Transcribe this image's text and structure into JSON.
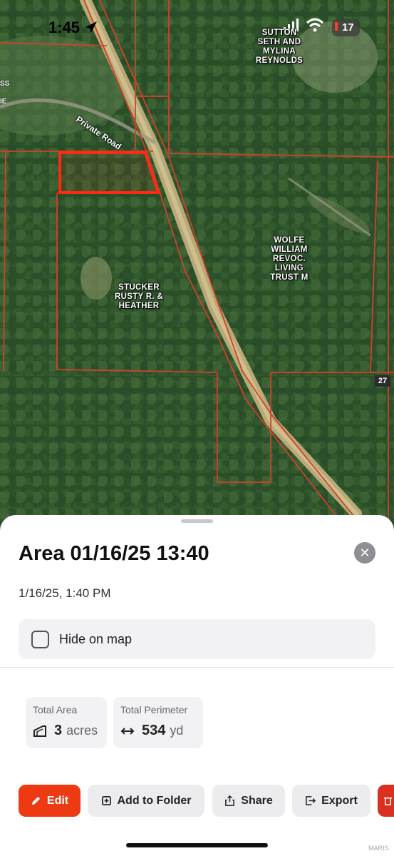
{
  "status_bar": {
    "time": "1:45",
    "battery": "17"
  },
  "map": {
    "labels": {
      "sutton": "SUTTON\nSETH AND\nMYLINA\nREYNOLDS",
      "wolfe": "WOLFE\nWILLIAM\nREVOC.\nLIVING\nTRUST M",
      "stucker": "STUCKER\nRUSTY R. &\nHEATHER",
      "road": "Private Road",
      "highway": "27",
      "edge_top": "SS",
      "edge_mid": "IE"
    }
  },
  "sheet": {
    "title": "Area 01/16/25 13:40",
    "subtitle": "1/16/25, 1:40 PM",
    "close_label": "✕",
    "hide_on_map": "Hide on map",
    "hide_on_map_checked": false,
    "stats": {
      "area_label": "Total Area",
      "area_value": "3",
      "area_unit": "acres",
      "perimeter_label": "Total Perimeter",
      "perimeter_value": "534",
      "perimeter_unit": "yd"
    },
    "buttons": {
      "edit": "Edit",
      "add_to_folder": "Add to Folder",
      "share": "Share",
      "export": "Export"
    }
  },
  "watermark": "MARIS",
  "colors": {
    "accent": "#ee3a12",
    "parcel_line": "#d2412a",
    "selected_area": "#ff2a14"
  }
}
